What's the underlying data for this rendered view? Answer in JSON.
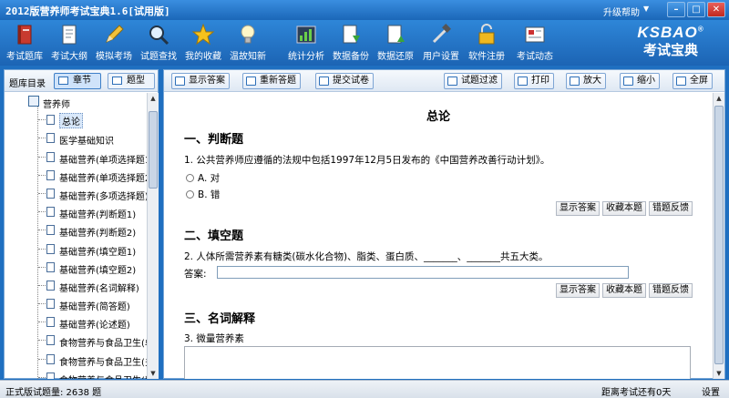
{
  "window": {
    "title": "2012版营养师考试宝典1.6[试用版]",
    "help": "升级帮助",
    "help_arrow": "▼",
    "minimize": "–",
    "maximize": "□",
    "close": "✕"
  },
  "toolbar": {
    "items": [
      {
        "label": "考试题库",
        "icon": "book-icon"
      },
      {
        "label": "考试大纲",
        "icon": "document-icon"
      },
      {
        "label": "模拟考场",
        "icon": "pencil-icon"
      },
      {
        "label": "试题查找",
        "icon": "magnifier-icon"
      },
      {
        "label": "我的收藏",
        "icon": "star-icon"
      },
      {
        "label": "温故知新",
        "icon": "lightbulb-icon"
      },
      {
        "label": "统计分析",
        "icon": "chart-icon"
      },
      {
        "label": "数据备份",
        "icon": "backup-icon"
      },
      {
        "label": "数据还原",
        "icon": "restore-icon"
      },
      {
        "label": "用户设置",
        "icon": "tools-icon"
      },
      {
        "label": "软件注册",
        "icon": "lock-icon"
      },
      {
        "label": "考试动态",
        "icon": "news-icon"
      }
    ],
    "logo_top": "KSBAO",
    "logo_bottom": "考试宝典",
    "logo_mark": "®"
  },
  "left_pane": {
    "header_label": "题库目录",
    "seg_chapter": "章节",
    "seg_type": "题型",
    "root": "营养师",
    "items": [
      "总论",
      "医学基础知识",
      "基础营养(单项选择题1",
      "基础营养(单项选择题2",
      "基础营养(多项选择题)",
      "基础营养(判断题1)",
      "基础营养(判断题2)",
      "基础营养(填空题1)",
      "基础营养(填空题2)",
      "基础营养(名词解释)",
      "基础营养(简答题)",
      "基础营养(论述题)",
      "食物营养与食品卫生(单",
      "食物营养与食品卫生(多",
      "食物营养与食品卫生(判"
    ]
  },
  "right_toolbar": {
    "show_answer": "显示答案",
    "redo": "重新答题",
    "submit": "提交试卷",
    "filter": "试题过滤",
    "print": "打印",
    "zoom_in": "放大",
    "zoom_out": "缩小",
    "fullscreen": "全屏"
  },
  "content": {
    "title": "总论",
    "sec1": "一、判断题",
    "q1": "1. 公共营养师应遵循的法规中包括1997年12月5日发布的《中国营养改善行动计划》。",
    "q1_opt_a": "A. 对",
    "q1_opt_b": "B. 错",
    "btn_show": "显示答案",
    "btn_fav": "收藏本题",
    "btn_report": "错题反馈",
    "sec2": "二、填空题",
    "q2": "2. 人体所需营养素有糖类(碳水化合物)、脂类、蛋白质、_______、_______共五大类。",
    "answer_label": "答案:",
    "sec3": "三、名词解释",
    "q3": "3. 微量营养素"
  },
  "status": {
    "left": "正式版试题量: 2638 题",
    "right": "距离考试还有0天",
    "settings": "设置"
  }
}
